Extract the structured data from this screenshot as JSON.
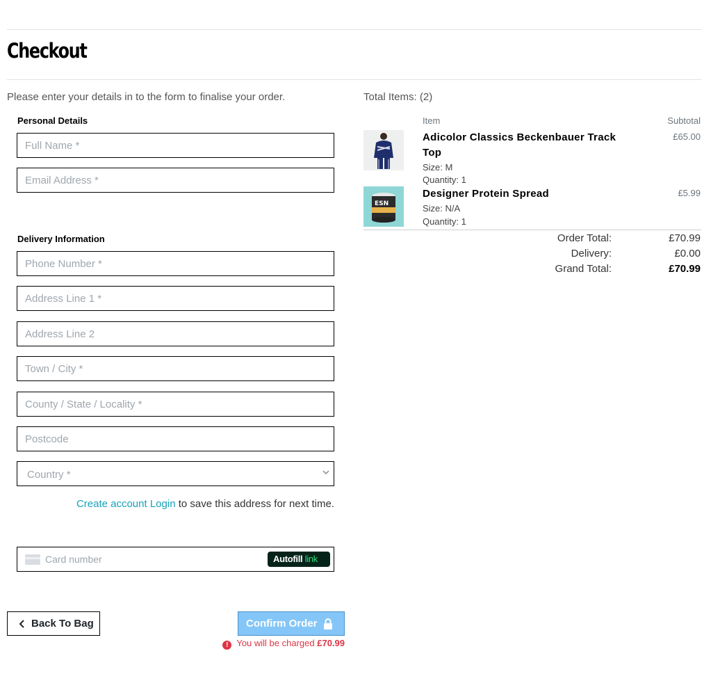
{
  "page": {
    "title": "Checkout",
    "intro": "Please enter your details in to the form to finalise your order."
  },
  "personal": {
    "label": "Personal Details",
    "full_name_placeholder": "Full Name *",
    "email_placeholder": "Email Address *"
  },
  "delivery": {
    "label": "Delivery Information",
    "phone_placeholder": "Phone Number *",
    "address1_placeholder": "Address Line 1 *",
    "address2_placeholder": "Address Line 2",
    "town_placeholder": "Town / City *",
    "county_placeholder": "County / State / Locality *",
    "postcode_placeholder": "Postcode",
    "country_placeholder": "Country *"
  },
  "account": {
    "create_label": "Create account",
    "login_label": "Login",
    "suffix": "to save this address for next time."
  },
  "payment": {
    "card_placeholder": "Card number",
    "autofill_label": "Autofill",
    "autofill_link": "link"
  },
  "actions": {
    "back_label": "Back To Bag",
    "confirm_label": "Confirm Order",
    "charge_prefix": "You will be charged",
    "charge_amount": "£70.99"
  },
  "summary": {
    "total_items": "Total Items: (2)",
    "col_item": "Item",
    "col_subtotal": "Subtotal",
    "items": [
      {
        "name_line1": "Adicolor Classics Beckenbauer Track",
        "name_line2": "Top",
        "size": "Size: M",
        "quantity": "Quantity: 1",
        "price": "£65.00",
        "image": "track-top-product-image"
      },
      {
        "name_line1": "Designer Protein Spread",
        "size": "Size: N/A",
        "quantity": "Quantity: 1",
        "price": "£5.99",
        "image": "protein-tub-product-image"
      }
    ],
    "order_total_label": "Order Total:",
    "order_total": "£70.99",
    "delivery_label": "Delivery:",
    "delivery": "£0.00",
    "grand_total_label": "Grand Total:",
    "grand_total": "£70.99"
  },
  "colors": {
    "accent_link": "#17a2b8",
    "confirm_button": "#84c6f7",
    "error": "#dc3545",
    "autofill_bg": "#06231a",
    "autofill_link": "#32e07a"
  }
}
